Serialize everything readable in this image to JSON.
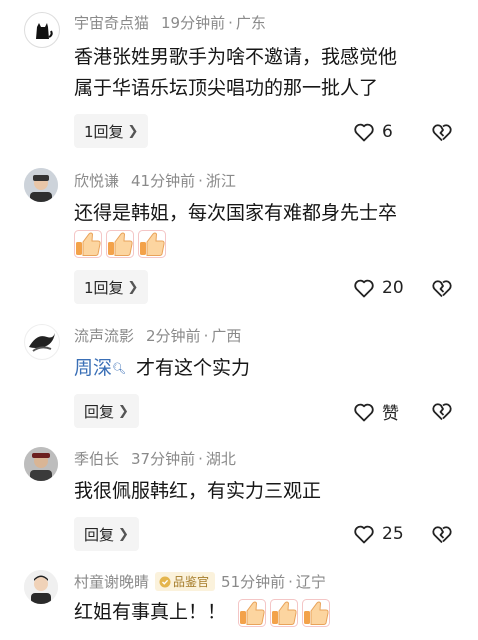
{
  "comments": [
    {
      "user": "宇宙奇点猫",
      "time": "19分钟前",
      "location": "广东",
      "text_line1": "香港张姓男歌手为啥不邀请，我感觉他",
      "text_line2": "属于华语乐坛顶尖唱功的那一批人了",
      "reply_label": "1回复",
      "likes": "6"
    },
    {
      "user": "欣悦谦",
      "time": "41分钟前",
      "location": "浙江",
      "text": "还得是韩姐，每次国家有难都身先士卒",
      "emojis": [
        "thumbs-up",
        "thumbs-up",
        "thumbs-up"
      ],
      "reply_label": "1回复",
      "likes": "20"
    },
    {
      "user": "流声流影",
      "time": "2分钟前",
      "location": "广西",
      "mention": "周深",
      "text": "才有这个实力",
      "reply_label": "回复",
      "likes": "赞"
    },
    {
      "user": "季伯长",
      "time": "37分钟前",
      "location": "湖北",
      "text": "我很佩服韩红，有实力三观正",
      "reply_label": "回复",
      "likes": "25"
    },
    {
      "user": "村童谢晚睛",
      "badge": "品鉴官",
      "time": "51分钟前",
      "location": "辽宁",
      "text": "红姐有事真上！！",
      "emojis": [
        "thumbs-up",
        "thumbs-up",
        "thumbs-up"
      ]
    }
  ],
  "separator": "·",
  "colors": {
    "meta": "#8a8a8a",
    "mention": "#3a6fb6",
    "text": "#161616",
    "reply_bg": "#f4f4f4",
    "badge_bg": "#fbf2dc"
  }
}
